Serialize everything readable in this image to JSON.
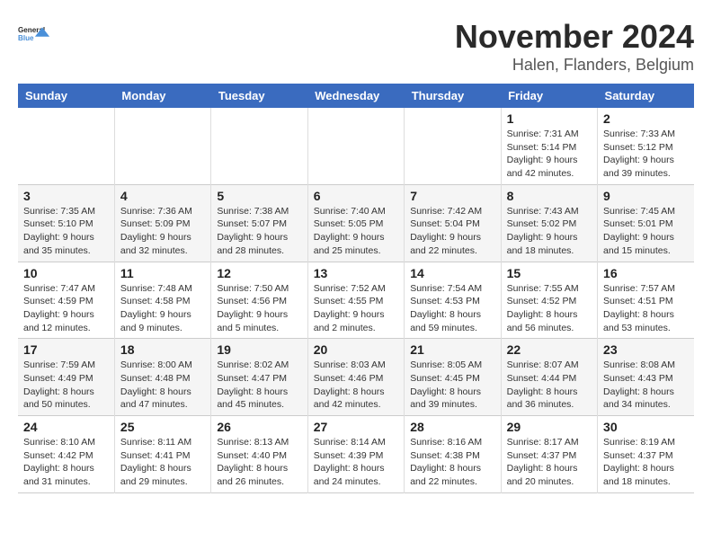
{
  "logo": {
    "line1": "General",
    "line2": "Blue"
  },
  "title": "November 2024",
  "location": "Halen, Flanders, Belgium",
  "days_of_week": [
    "Sunday",
    "Monday",
    "Tuesday",
    "Wednesday",
    "Thursday",
    "Friday",
    "Saturday"
  ],
  "weeks": [
    [
      {
        "day": "",
        "info": ""
      },
      {
        "day": "",
        "info": ""
      },
      {
        "day": "",
        "info": ""
      },
      {
        "day": "",
        "info": ""
      },
      {
        "day": "",
        "info": ""
      },
      {
        "day": "1",
        "info": "Sunrise: 7:31 AM\nSunset: 5:14 PM\nDaylight: 9 hours and 42 minutes."
      },
      {
        "day": "2",
        "info": "Sunrise: 7:33 AM\nSunset: 5:12 PM\nDaylight: 9 hours and 39 minutes."
      }
    ],
    [
      {
        "day": "3",
        "info": "Sunrise: 7:35 AM\nSunset: 5:10 PM\nDaylight: 9 hours and 35 minutes."
      },
      {
        "day": "4",
        "info": "Sunrise: 7:36 AM\nSunset: 5:09 PM\nDaylight: 9 hours and 32 minutes."
      },
      {
        "day": "5",
        "info": "Sunrise: 7:38 AM\nSunset: 5:07 PM\nDaylight: 9 hours and 28 minutes."
      },
      {
        "day": "6",
        "info": "Sunrise: 7:40 AM\nSunset: 5:05 PM\nDaylight: 9 hours and 25 minutes."
      },
      {
        "day": "7",
        "info": "Sunrise: 7:42 AM\nSunset: 5:04 PM\nDaylight: 9 hours and 22 minutes."
      },
      {
        "day": "8",
        "info": "Sunrise: 7:43 AM\nSunset: 5:02 PM\nDaylight: 9 hours and 18 minutes."
      },
      {
        "day": "9",
        "info": "Sunrise: 7:45 AM\nSunset: 5:01 PM\nDaylight: 9 hours and 15 minutes."
      }
    ],
    [
      {
        "day": "10",
        "info": "Sunrise: 7:47 AM\nSunset: 4:59 PM\nDaylight: 9 hours and 12 minutes."
      },
      {
        "day": "11",
        "info": "Sunrise: 7:48 AM\nSunset: 4:58 PM\nDaylight: 9 hours and 9 minutes."
      },
      {
        "day": "12",
        "info": "Sunrise: 7:50 AM\nSunset: 4:56 PM\nDaylight: 9 hours and 5 minutes."
      },
      {
        "day": "13",
        "info": "Sunrise: 7:52 AM\nSunset: 4:55 PM\nDaylight: 9 hours and 2 minutes."
      },
      {
        "day": "14",
        "info": "Sunrise: 7:54 AM\nSunset: 4:53 PM\nDaylight: 8 hours and 59 minutes."
      },
      {
        "day": "15",
        "info": "Sunrise: 7:55 AM\nSunset: 4:52 PM\nDaylight: 8 hours and 56 minutes."
      },
      {
        "day": "16",
        "info": "Sunrise: 7:57 AM\nSunset: 4:51 PM\nDaylight: 8 hours and 53 minutes."
      }
    ],
    [
      {
        "day": "17",
        "info": "Sunrise: 7:59 AM\nSunset: 4:49 PM\nDaylight: 8 hours and 50 minutes."
      },
      {
        "day": "18",
        "info": "Sunrise: 8:00 AM\nSunset: 4:48 PM\nDaylight: 8 hours and 47 minutes."
      },
      {
        "day": "19",
        "info": "Sunrise: 8:02 AM\nSunset: 4:47 PM\nDaylight: 8 hours and 45 minutes."
      },
      {
        "day": "20",
        "info": "Sunrise: 8:03 AM\nSunset: 4:46 PM\nDaylight: 8 hours and 42 minutes."
      },
      {
        "day": "21",
        "info": "Sunrise: 8:05 AM\nSunset: 4:45 PM\nDaylight: 8 hours and 39 minutes."
      },
      {
        "day": "22",
        "info": "Sunrise: 8:07 AM\nSunset: 4:44 PM\nDaylight: 8 hours and 36 minutes."
      },
      {
        "day": "23",
        "info": "Sunrise: 8:08 AM\nSunset: 4:43 PM\nDaylight: 8 hours and 34 minutes."
      }
    ],
    [
      {
        "day": "24",
        "info": "Sunrise: 8:10 AM\nSunset: 4:42 PM\nDaylight: 8 hours and 31 minutes."
      },
      {
        "day": "25",
        "info": "Sunrise: 8:11 AM\nSunset: 4:41 PM\nDaylight: 8 hours and 29 minutes."
      },
      {
        "day": "26",
        "info": "Sunrise: 8:13 AM\nSunset: 4:40 PM\nDaylight: 8 hours and 26 minutes."
      },
      {
        "day": "27",
        "info": "Sunrise: 8:14 AM\nSunset: 4:39 PM\nDaylight: 8 hours and 24 minutes."
      },
      {
        "day": "28",
        "info": "Sunrise: 8:16 AM\nSunset: 4:38 PM\nDaylight: 8 hours and 22 minutes."
      },
      {
        "day": "29",
        "info": "Sunrise: 8:17 AM\nSunset: 4:37 PM\nDaylight: 8 hours and 20 minutes."
      },
      {
        "day": "30",
        "info": "Sunrise: 8:19 AM\nSunset: 4:37 PM\nDaylight: 8 hours and 18 minutes."
      }
    ]
  ]
}
